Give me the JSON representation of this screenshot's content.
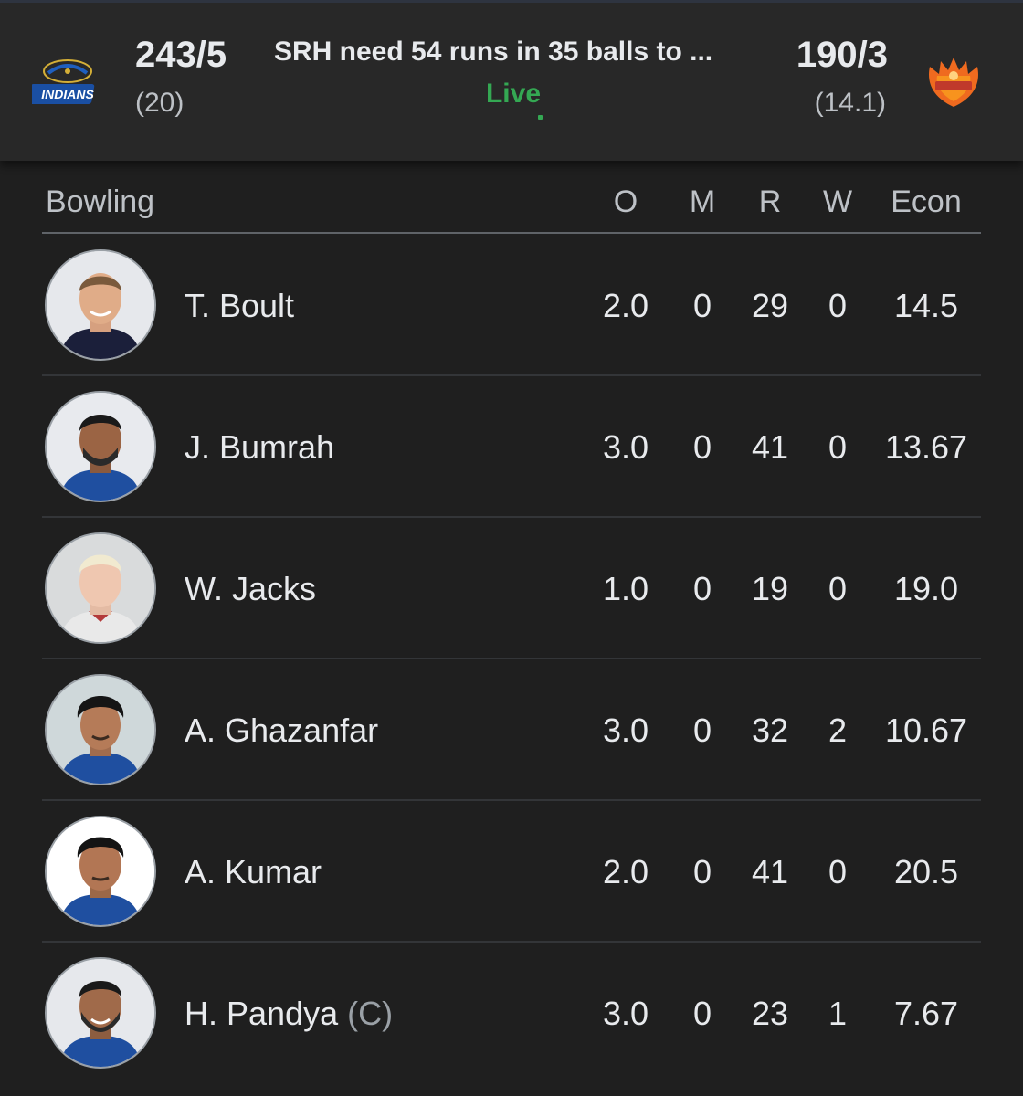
{
  "match": {
    "home": {
      "logo": "mumbai-indians-logo",
      "score": "243/5",
      "overs": "(20)"
    },
    "away": {
      "logo": "sunrisers-hyderabad-logo",
      "score": "190/3",
      "overs": "(14.1)"
    },
    "status": "SRH need 54 runs in 35 balls to ...",
    "live_label": "Live"
  },
  "bowling": {
    "title": "Bowling",
    "columns": {
      "overs": "O",
      "maidens": "M",
      "runs": "R",
      "wickets": "W",
      "economy": "Econ"
    },
    "rows": [
      {
        "name": "T. Boult",
        "captain": "",
        "O": "2.0",
        "M": "0",
        "R": "29",
        "W": "0",
        "Econ": "14.5",
        "avatar_bg": "#e6e8ec"
      },
      {
        "name": "J. Bumrah",
        "captain": "",
        "O": "3.0",
        "M": "0",
        "R": "41",
        "W": "0",
        "Econ": "13.67",
        "avatar_bg": "#e8eaee"
      },
      {
        "name": "W. Jacks",
        "captain": "",
        "O": "1.0",
        "M": "0",
        "R": "19",
        "W": "0",
        "Econ": "19.0",
        "avatar_bg": "#d9dbdc"
      },
      {
        "name": "A. Ghazanfar",
        "captain": "",
        "O": "3.0",
        "M": "0",
        "R": "32",
        "W": "2",
        "Econ": "10.67",
        "avatar_bg": "#cfd8da"
      },
      {
        "name": "A. Kumar",
        "captain": "",
        "O": "2.0",
        "M": "0",
        "R": "41",
        "W": "0",
        "Econ": "20.5",
        "avatar_bg": "#ffffff"
      },
      {
        "name": "H. Pandya",
        "captain": "(C)",
        "O": "3.0",
        "M": "0",
        "R": "23",
        "W": "1",
        "Econ": "7.67",
        "avatar_bg": "#e6e8ec"
      }
    ]
  },
  "colors": {
    "live": "#34a853",
    "background": "#1f1f1f",
    "header": "#282828"
  }
}
